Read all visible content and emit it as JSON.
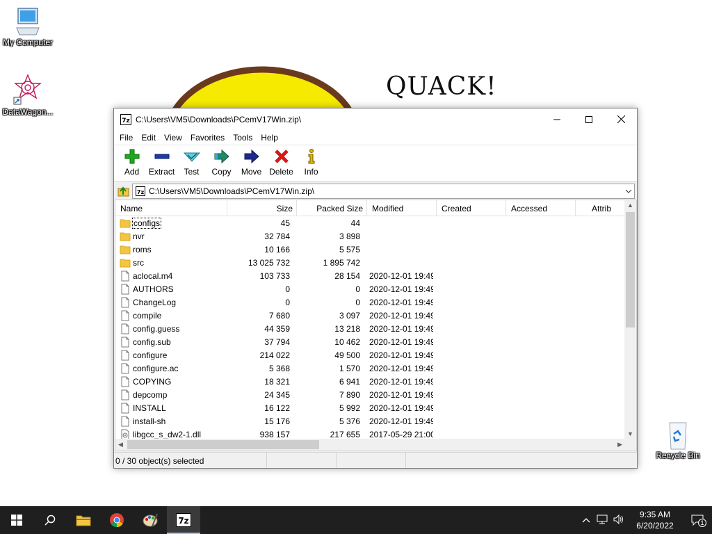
{
  "desktop": {
    "icons": [
      {
        "label": "My Computer"
      },
      {
        "label": "DataWagon..."
      },
      {
        "label": "Recycle Bin"
      }
    ],
    "wallpaper_text": "QUACK!"
  },
  "window": {
    "title": "C:\\Users\\VM5\\Downloads\\PCemV17Win.zip\\",
    "menu": [
      "File",
      "Edit",
      "View",
      "Favorites",
      "Tools",
      "Help"
    ],
    "toolbar": {
      "add": "Add",
      "extract": "Extract",
      "test": "Test",
      "copy": "Copy",
      "move": "Move",
      "delete": "Delete",
      "info": "Info"
    },
    "address": "C:\\Users\\VM5\\Downloads\\PCemV17Win.zip\\",
    "columns": {
      "name": "Name",
      "size": "Size",
      "packed": "Packed Size",
      "modified": "Modified",
      "created": "Created",
      "accessed": "Accessed",
      "attrib": "Attrib"
    },
    "rows": [
      {
        "name": "configs",
        "size": "45",
        "packed": "44",
        "modified": "",
        "type": "folder"
      },
      {
        "name": "nvr",
        "size": "32 784",
        "packed": "3 898",
        "modified": "",
        "type": "folder"
      },
      {
        "name": "roms",
        "size": "10 166",
        "packed": "5 575",
        "modified": "",
        "type": "folder"
      },
      {
        "name": "src",
        "size": "13 025 732",
        "packed": "1 895 742",
        "modified": "",
        "type": "folder"
      },
      {
        "name": "aclocal.m4",
        "size": "103 733",
        "packed": "28 154",
        "modified": "2020-12-01 19:49",
        "type": "file"
      },
      {
        "name": "AUTHORS",
        "size": "0",
        "packed": "0",
        "modified": "2020-12-01 19:49",
        "type": "file"
      },
      {
        "name": "ChangeLog",
        "size": "0",
        "packed": "0",
        "modified": "2020-12-01 19:49",
        "type": "file"
      },
      {
        "name": "compile",
        "size": "7 680",
        "packed": "3 097",
        "modified": "2020-12-01 19:49",
        "type": "file"
      },
      {
        "name": "config.guess",
        "size": "44 359",
        "packed": "13 218",
        "modified": "2020-12-01 19:49",
        "type": "file"
      },
      {
        "name": "config.sub",
        "size": "37 794",
        "packed": "10 462",
        "modified": "2020-12-01 19:49",
        "type": "file"
      },
      {
        "name": "configure",
        "size": "214 022",
        "packed": "49 500",
        "modified": "2020-12-01 19:49",
        "type": "file"
      },
      {
        "name": "configure.ac",
        "size": "5 368",
        "packed": "1 570",
        "modified": "2020-12-01 19:49",
        "type": "file"
      },
      {
        "name": "COPYING",
        "size": "18 321",
        "packed": "6 941",
        "modified": "2020-12-01 19:49",
        "type": "file"
      },
      {
        "name": "depcomp",
        "size": "24 345",
        "packed": "7 890",
        "modified": "2020-12-01 19:49",
        "type": "file"
      },
      {
        "name": "INSTALL",
        "size": "16 122",
        "packed": "5 992",
        "modified": "2020-12-01 19:49",
        "type": "file"
      },
      {
        "name": "install-sh",
        "size": "15 176",
        "packed": "5 376",
        "modified": "2020-12-01 19:49",
        "type": "file"
      },
      {
        "name": "libgcc_s_dw2-1.dll",
        "size": "938 157",
        "packed": "217 655",
        "modified": "2017-05-29 21:00",
        "type": "dll"
      }
    ],
    "status": "0 / 30 object(s) selected"
  },
  "taskbar": {
    "time": "9:35 AM",
    "date": "6/20/2022",
    "notification_count": "1"
  },
  "colors": {
    "folder": "#f4c542",
    "taskbar": "#1f1f1f",
    "add_green": "#1ea81e",
    "extract_blue": "#1e3aa8",
    "delete_red": "#d81818"
  }
}
